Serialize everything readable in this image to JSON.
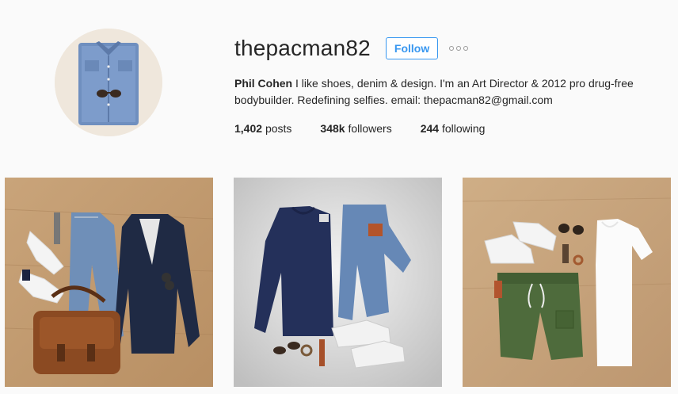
{
  "profile": {
    "username": "thepacman82",
    "follow_label": "Follow",
    "full_name": "Phil Cohen",
    "bio": " I like shoes, denim & design. I'm an Art Director & 2012 pro drug-free bodybuilder. Redefining selfies. email: thepacman82@gmail.com",
    "stats": {
      "posts_count": "1,402",
      "posts_label": "posts",
      "followers_count": "348k",
      "followers_label": "followers",
      "following_count": "244",
      "following_label": "following"
    }
  },
  "colors": {
    "accent": "#3897f0",
    "text": "#262626",
    "background": "#fafafa"
  },
  "icons": {
    "more": "more-options-icon"
  },
  "posts": [
    {
      "name": "post-outfit-navy-blazer"
    },
    {
      "name": "post-outfit-navy-sweater"
    },
    {
      "name": "post-outfit-green-shorts"
    }
  ]
}
